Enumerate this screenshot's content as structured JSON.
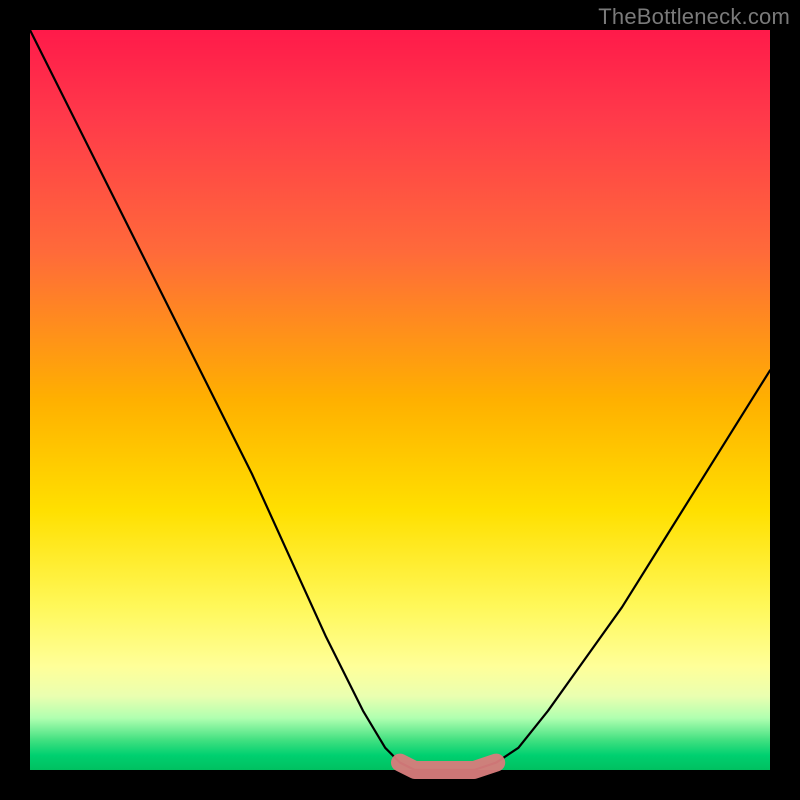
{
  "watermark": {
    "text": "TheBottleneck.com"
  },
  "colors": {
    "background": "#000000",
    "curve": "#000000",
    "highlight": "#d87c7c",
    "gradient_top": "#ff1a4a",
    "gradient_bottom": "#00c060"
  },
  "chart_data": {
    "type": "line",
    "title": "",
    "xlabel": "",
    "ylabel": "",
    "xlim": [
      0,
      100
    ],
    "ylim": [
      0,
      100
    ],
    "grid": false,
    "legend": false,
    "series": [
      {
        "name": "bottleneck-curve",
        "x": [
          0,
          5,
          10,
          15,
          20,
          25,
          30,
          35,
          40,
          45,
          48,
          50,
          52,
          55,
          58,
          60,
          63,
          66,
          70,
          75,
          80,
          85,
          90,
          95,
          100
        ],
        "values": [
          100,
          90,
          80,
          70,
          60,
          50,
          40,
          29,
          18,
          8,
          3,
          1,
          0,
          0,
          0,
          0,
          1,
          3,
          8,
          15,
          22,
          30,
          38,
          46,
          54
        ]
      }
    ],
    "highlight_range_x": [
      50,
      63
    ],
    "annotations": []
  }
}
